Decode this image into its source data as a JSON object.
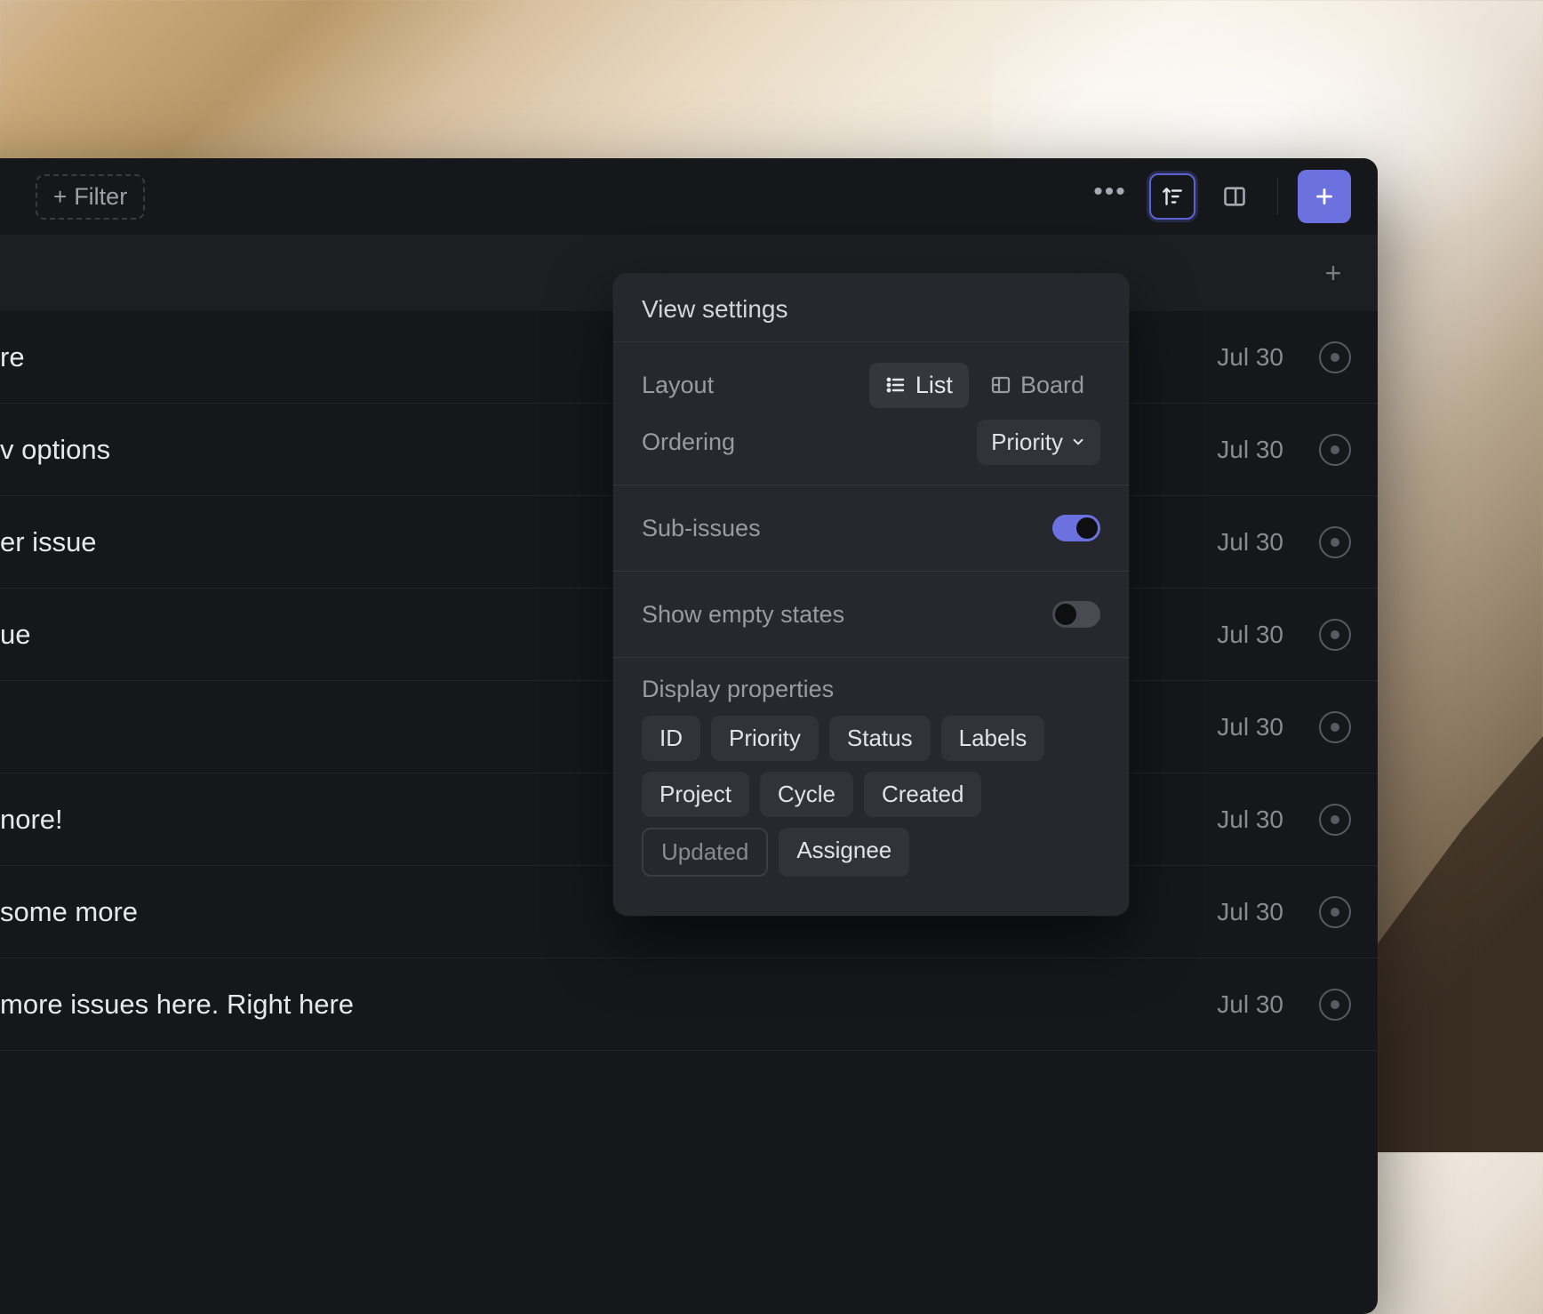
{
  "toolbar": {
    "filter_label": "Filter",
    "plus_glyph": "+"
  },
  "header": {
    "add_glyph": "+"
  },
  "issues": [
    {
      "title_fragment": "re",
      "date": "Jul 30"
    },
    {
      "title_fragment": "v options",
      "date": "Jul 30"
    },
    {
      "title_fragment": "er issue",
      "date": "Jul 30"
    },
    {
      "title_fragment": "ue",
      "date": "Jul 30"
    },
    {
      "title_fragment": "",
      "date": "Jul 30"
    },
    {
      "title_fragment": "nore!",
      "date": "Jul 30"
    },
    {
      "title_fragment": "some more",
      "date": "Jul 30"
    },
    {
      "title_fragment": "more issues here. Right here",
      "date": "Jul 30"
    }
  ],
  "popover": {
    "title": "View settings",
    "layout_label": "Layout",
    "layout_list": "List",
    "layout_board": "Board",
    "ordering_label": "Ordering",
    "ordering_value": "Priority",
    "subissues_label": "Sub-issues",
    "subissues_on": true,
    "showempty_label": "Show empty states",
    "showempty_on": false,
    "display_props_label": "Display properties",
    "chips": [
      {
        "label": "ID",
        "on": true
      },
      {
        "label": "Priority",
        "on": true
      },
      {
        "label": "Status",
        "on": true
      },
      {
        "label": "Labels",
        "on": true
      },
      {
        "label": "Project",
        "on": true
      },
      {
        "label": "Cycle",
        "on": true
      },
      {
        "label": "Created",
        "on": true
      },
      {
        "label": "Updated",
        "on": false
      },
      {
        "label": "Assignee",
        "on": true
      }
    ]
  }
}
